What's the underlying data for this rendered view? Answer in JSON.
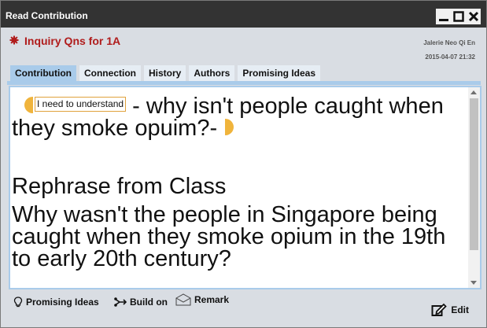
{
  "window": {
    "title": "Read Contribution",
    "controls": [
      "minimize-icon",
      "maximize-icon",
      "close-icon"
    ]
  },
  "header": {
    "icon": "gear-icon",
    "title": "Inquiry Qns for 1A",
    "author": "Jalerie Neo Qi En",
    "date": "2015-04-07 21:32",
    "accent_color": "#b01c1c"
  },
  "tabs": [
    {
      "label": "Contribution",
      "active": true
    },
    {
      "label": "Connection",
      "active": false
    },
    {
      "label": "History",
      "active": false
    },
    {
      "label": "Authors",
      "active": false
    },
    {
      "label": "Promising Ideas",
      "active": false
    }
  ],
  "content": {
    "scaffold_label": "I need to understand",
    "line1": "- why isn't people caught when they smoke opuim?-",
    "heading": "Rephrase from Class",
    "body": "Why wasn't the people in Singapore being caught when they smoke opium in the 19th to early 20th century?"
  },
  "footer": {
    "promising_ideas": "Promising Ideas",
    "build_on": "Build on",
    "remark": "Remark",
    "edit": "Edit"
  }
}
